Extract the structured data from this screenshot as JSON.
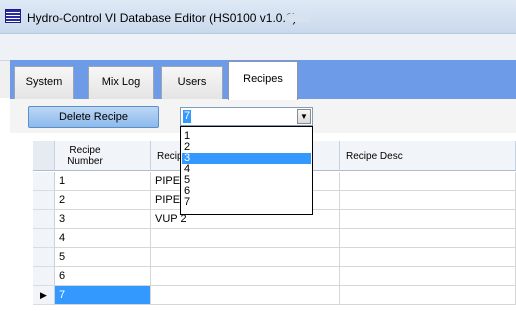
{
  "window": {
    "title": "Hydro-Control VI Database Editor (HS0100 v1.0.0)"
  },
  "tabs": [
    {
      "label": "System",
      "active": false
    },
    {
      "label": "Mix Log",
      "active": false
    },
    {
      "label": "Users",
      "active": false
    },
    {
      "label": "Recipes",
      "active": true
    }
  ],
  "toolbar": {
    "delete_label": "Delete Recipe",
    "recipe_select": {
      "value": "7",
      "options": [
        "1",
        "2",
        "3",
        "4",
        "5",
        "6",
        "7"
      ],
      "highlighted": "3"
    }
  },
  "grid": {
    "columns": [
      "Recipe Number",
      "Recipe Name",
      "Recipe Desc"
    ],
    "rows": [
      {
        "number": "1",
        "name": "PIPE",
        "desc": ""
      },
      {
        "number": "2",
        "name": "PIPE",
        "desc": ""
      },
      {
        "number": "3",
        "name": "VUP 2",
        "desc": ""
      },
      {
        "number": "4",
        "name": "",
        "desc": ""
      },
      {
        "number": "5",
        "name": "",
        "desc": ""
      },
      {
        "number": "6",
        "name": "",
        "desc": ""
      },
      {
        "number": "7",
        "name": "",
        "desc": "",
        "current": true
      }
    ]
  },
  "colors": {
    "accent": "#3399ff",
    "tab_strip": "#6d9be7",
    "button": "#8dbaec"
  },
  "icons": {
    "app": "app-list-icon",
    "combo": "chevron-down-icon",
    "current_row": "row-pointer-icon"
  }
}
